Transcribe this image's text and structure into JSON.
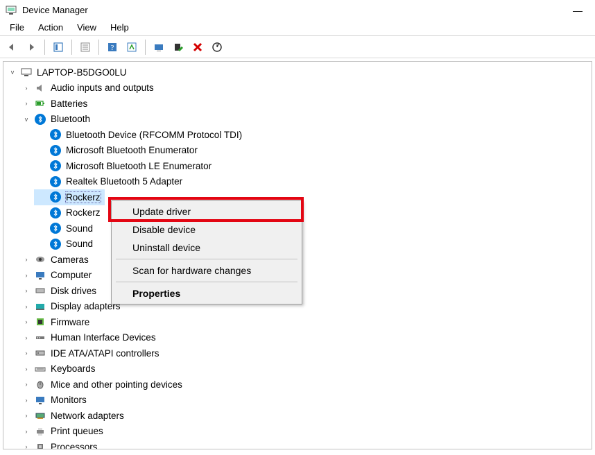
{
  "window": {
    "title": "Device Manager",
    "minimize": "—"
  },
  "menu": {
    "file": "File",
    "action": "Action",
    "view": "View",
    "help": "Help"
  },
  "tree": {
    "root": "LAPTOP-B5DGO0LU",
    "audio": "Audio inputs and outputs",
    "batteries": "Batteries",
    "bluetooth": "Bluetooth",
    "bt_items": {
      "rfcomm": "Bluetooth Device (RFCOMM Protocol TDI)",
      "enum": "Microsoft Bluetooth Enumerator",
      "le_enum": "Microsoft Bluetooth LE Enumerator",
      "realtek": "Realtek Bluetooth 5 Adapter",
      "rockerz1": "Rockerz",
      "rockerz2": "Rockerz",
      "sound1": "Sound",
      "sound2": "Sound"
    },
    "cameras": "Cameras",
    "computer": "Computer",
    "disk": "Disk drives",
    "display": "Display adapters",
    "firmware": "Firmware",
    "hid": "Human Interface Devices",
    "ide": "IDE ATA/ATAPI controllers",
    "keyboards": "Keyboards",
    "mice": "Mice and other pointing devices",
    "monitors": "Monitors",
    "network": "Network adapters",
    "print": "Print queues",
    "processors": "Processors"
  },
  "context_menu": {
    "update": "Update driver",
    "disable": "Disable device",
    "uninstall": "Uninstall device",
    "scan": "Scan for hardware changes",
    "properties": "Properties"
  }
}
